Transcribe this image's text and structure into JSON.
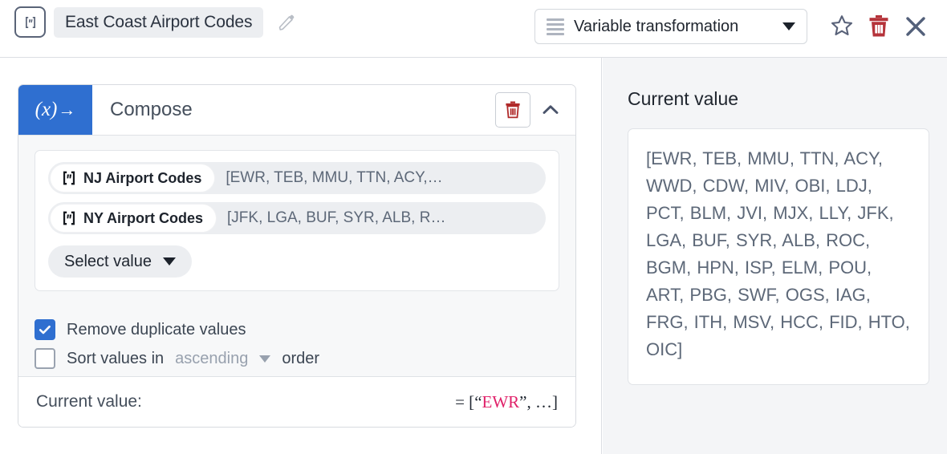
{
  "topbar": {
    "var_type_icon": "string-variable-icon",
    "title": "East Coast Airport Codes",
    "edit_icon": "pencil-icon",
    "transform_select": {
      "icon": "list-icon",
      "label": "Variable transformation",
      "caret": "chevron-down-icon"
    },
    "favorite_icon": "star-icon",
    "delete_icon": "trash-icon",
    "close_icon": "close-icon"
  },
  "compose": {
    "badge": "(x)",
    "badge_arrow": "→",
    "title": "Compose",
    "delete_icon": "trash-icon",
    "collapse_icon": "chevron-up-icon",
    "slots": [
      {
        "pill_icon": "string-variable-icon",
        "pill_label": "NJ Airport Codes",
        "value": "[EWR, TEB, MMU, TTN, ACY,…"
      },
      {
        "pill_icon": "string-variable-icon",
        "pill_label": "NY Airport Codes",
        "value": "[JFK, LGA, BUF, SYR, ALB, R…"
      }
    ],
    "add_slot": {
      "label": "Select value",
      "caret": "chevron-down-icon"
    },
    "options": [
      {
        "label": "Remove duplicate values",
        "checked": true
      },
      {
        "label_before": "Sort values in",
        "dropdown": "ascending",
        "label_after": "order",
        "checked": false
      }
    ],
    "footer": {
      "label": "Current value:",
      "equals": "= [",
      "quote_open": "“",
      "accent_value": "EWR",
      "quote_close": "”",
      "tail": ", …]"
    }
  },
  "current_value_panel": {
    "title": "Current value",
    "value": "[EWR, TEB, MMU, TTN, ACY, WWD, CDW, MIV, OBI, LDJ, PCT, BLM, JVI, MJX, LLY, JFK, LGA, BUF, SYR, ALB, ROC, BGM, HPN, ISP, ELM, POU, ART, PBG, SWF, OGS, IAG, FRG, ITH, MSV, HCC, FID, HTO, OIC]"
  },
  "colors": {
    "accent_blue": "#2f6fd0",
    "danger_red": "#b5333a",
    "compose_trash_red": "#b02a2a",
    "value_text": "#5d6878",
    "pink_accent": "#e02169"
  }
}
